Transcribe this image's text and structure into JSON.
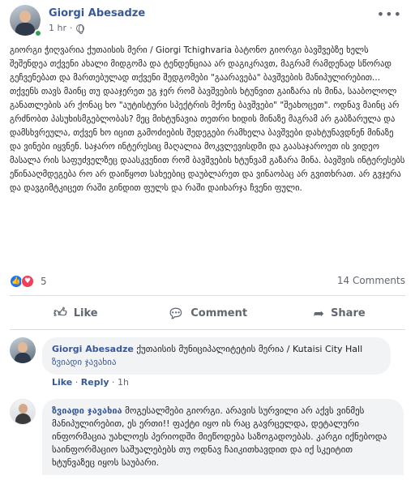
{
  "post": {
    "author": "Giorgi Abesadze",
    "time": "1 hr",
    "more_icon": "ellipsis-icon",
    "text": "გიორგი ჭიღვარია ქუთაისის მერი / Giorgi Tchighvaria ბატონო გიორგი ბავშვებზე ხელს შეშენდეა თქვენი ახალი მიდგომა და ტენდენციაა არ დაგიკრავთ, მაგრამ რამდენად სწორად გეჩვენებათ და მართებულად თქვენი შედგომები \"გაარავება\" ბავშვების მანიპულირებით... თქვენს თავს მაინც თუ დააჯერეთ ეგ ჯერ რომ ბავშვების ხტუნვით გაიზარა ის მინა, სააბოლოლ განათლების არ ქონაც ხო \"აუტისტური სპექტრის მქონე ბავშვები\" \"შეახოცეთ\". ოდნავ მაინც არ გრძნობთ პასუხისმგებლობას? მეც მიხტუნავია თეთრი ხიდის მინაზე მაგრამ არ გაბზარულა და დამსხვრეულა, თქვენ ხო იცით გამოძიების შედეგები რამხელა ბავშვები დახტუნავდნენ მინაზე და ვინები იყვნენ. საჯარო ინტერესიც მაღალია მოკვლევისდმი და გაასაჯაროეთ ის ვიდეო მასალა რის საფუძველზეც დაასკვენით რომ ბავშვების ხტუნვამ გაზარა მინა. ბავშვის ინტერესებს ეწინააღმდეგება რო არ დაიწყოთ სახეებიც დაუბლარეთ და ვინაობაც არ გვითხრათ. არ გვჯერა და დავგიმტკიცეთ რაში გინდით ფულს და რაში დაიხარჯა ჩვენი ფული.",
    "reactions": {
      "like_icon": "thumbs-up-icon",
      "love_icon": "heart-icon",
      "count": "5"
    },
    "comments_count": "14 Comments"
  },
  "actions": {
    "like": "Like",
    "comment": "Comment",
    "share": "Share"
  },
  "comments": [
    {
      "author": "Giorgi Abesadze",
      "text": "ქუთაისის მუნიციპალიტეტის მერია / Kutaisi City Hall",
      "tagged": "ზვიადი ჯავახია",
      "like": "Like",
      "reply": "Reply",
      "time": "1h"
    },
    {
      "author": "ზვიადი ჯავახია",
      "text": "მოგესალმები გიორგი. არავის სურვილი არ აქვს ვინმეს მანიპულირებით, ეს ერთი!! ფაქტი იყო ის რაც გავრცელდა, დეტალური ინფორმაცია უახლოეს პერიოდში მიეწოდება საზოგადოებას. კარგი იქნებოდა საინფორმაციო საშუალებებს თუ ოდნავ ჩაიკითხავდით და იქ სკეიტით ხტუნვაზეც იყოს საუბარი."
    }
  ]
}
